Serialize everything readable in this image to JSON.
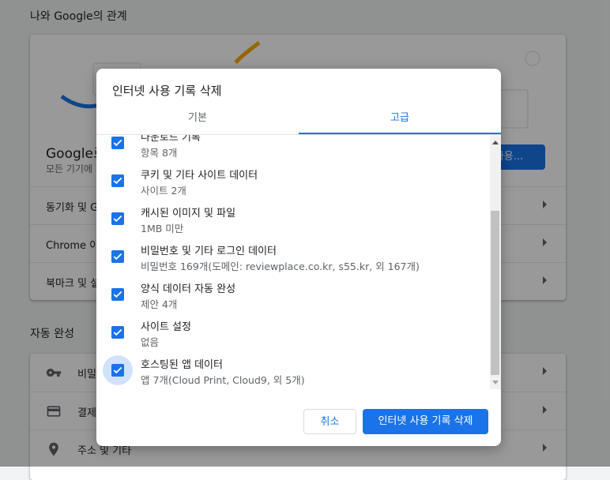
{
  "background": {
    "section1_title": "나와 Google의 관계",
    "google_row_title": "Google로",
    "google_row_sub": "모든 기기에",
    "sync_button_label": "사용...",
    "rows1": [
      "동기화 및 G",
      "Chrome 이",
      "북마크 및 설"
    ],
    "section2_title": "자동 완성",
    "rows2": [
      {
        "icon": "key-icon",
        "label": "비밀"
      },
      {
        "icon": "credit-card-icon",
        "label": "결제"
      },
      {
        "icon": "location-pin-icon",
        "label": "주소 및 기타"
      }
    ]
  },
  "dialog": {
    "title": "인터넷 사용 기록 삭제",
    "tabs": [
      {
        "label": "기본",
        "active": false
      },
      {
        "label": "고급",
        "active": true
      }
    ],
    "items": [
      {
        "title": "다운로드 기록",
        "subtitle": "항목 8개",
        "checked": true
      },
      {
        "title": "쿠키 및 기타 사이트 데이터",
        "subtitle": "사이트 2개",
        "checked": true
      },
      {
        "title": "캐시된 이미지 및 파일",
        "subtitle": "1MB 미만",
        "checked": true
      },
      {
        "title": "비밀번호 및 기타 로그인 데이터",
        "subtitle": "비밀번호 169개(도메인: reviewplace.co.kr, s55.kr, 외 167개)",
        "checked": true
      },
      {
        "title": "양식 데이터 자동 완성",
        "subtitle": "제안 4개",
        "checked": true
      },
      {
        "title": "사이트 설정",
        "subtitle": "없음",
        "checked": true
      },
      {
        "title": "호스팅된 앱 데이터",
        "subtitle": "앱 7개(Cloud Print, Cloud9, 외 5개)",
        "checked": true
      }
    ],
    "cancel_label": "취소",
    "confirm_label": "인터넷 사용 기록 삭제"
  },
  "colors": {
    "accent": "#1a73e8",
    "scrim": "rgba(0,0,0,0.4)",
    "background": "#f1f3f4"
  }
}
